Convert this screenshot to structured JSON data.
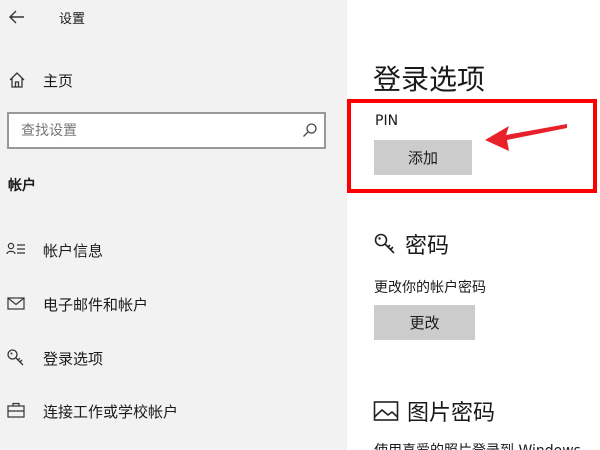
{
  "window": {
    "title": "设置"
  },
  "sidebar": {
    "home_label": "主页",
    "search": {
      "placeholder": "查找设置",
      "value": ""
    },
    "section_label": "帐户",
    "items": [
      {
        "label": "帐户信息",
        "icon": "account-info-icon"
      },
      {
        "label": "电子邮件和帐户",
        "icon": "mail-icon"
      },
      {
        "label": "登录选项",
        "icon": "key-icon"
      },
      {
        "label": "连接工作或学校帐户",
        "icon": "briefcase-icon"
      }
    ]
  },
  "main": {
    "title": "登录选项",
    "pin": {
      "label": "PIN",
      "button": "添加"
    },
    "password": {
      "heading": "密码",
      "description": "更改你的帐户密码",
      "button": "更改"
    },
    "picture_password": {
      "heading": "图片密码",
      "description": "使用喜爱的照片登录到 Windows"
    }
  },
  "colors": {
    "sidebar_bg": "#f2f2f2",
    "highlight": "#ff0000",
    "button_bg": "#cccccc",
    "arrow": "#e8202a"
  }
}
